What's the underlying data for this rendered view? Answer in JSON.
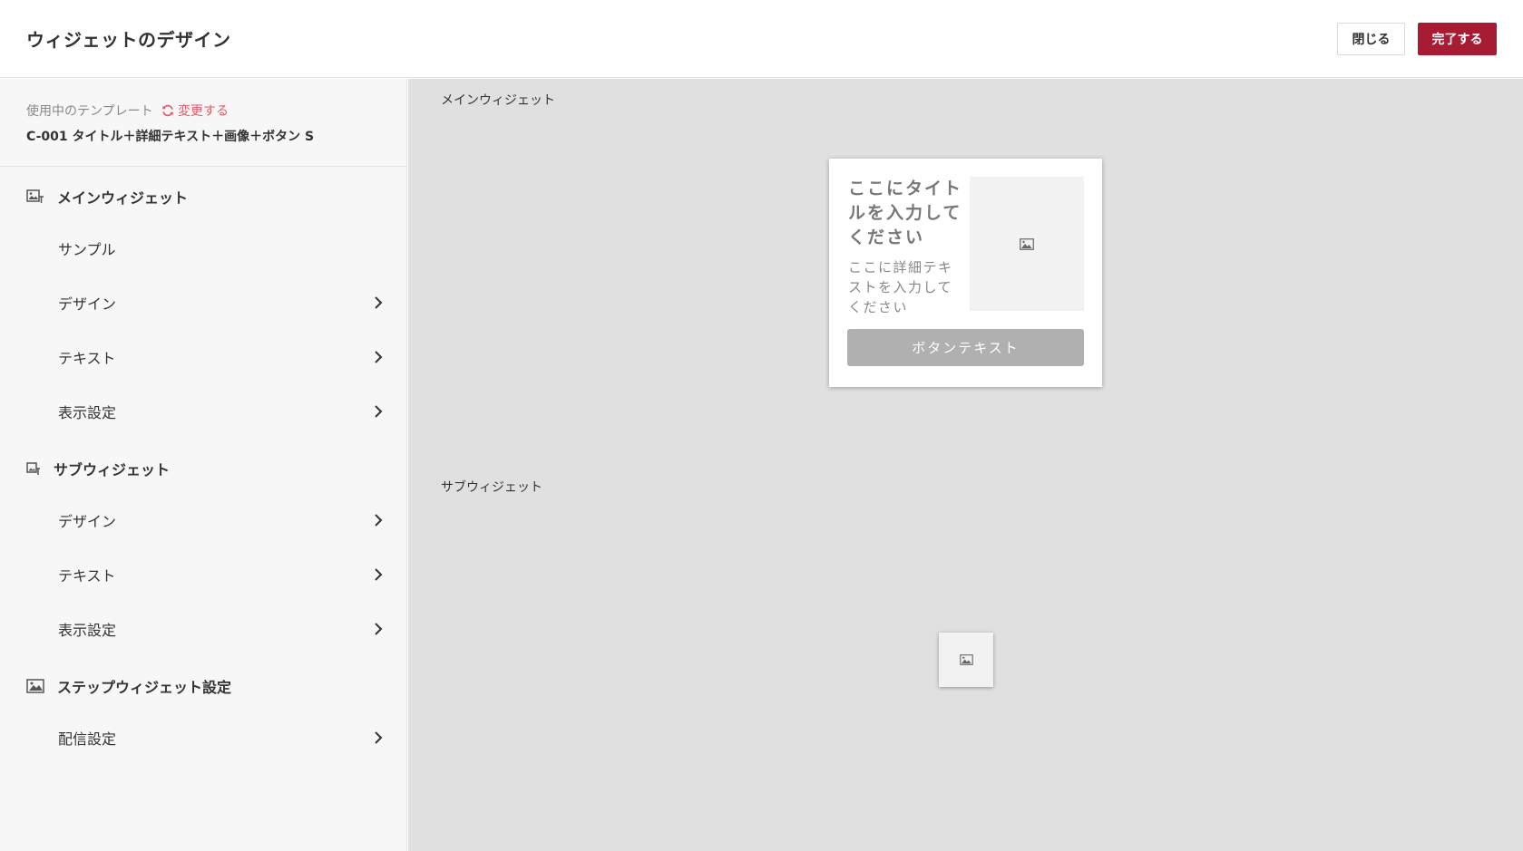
{
  "header": {
    "title": "ウィジェットのデザイン",
    "close_label": "閉じる",
    "done_label": "完了する"
  },
  "template": {
    "label": "使用中のテンプレート",
    "change_label": "変更する",
    "name": "C-001 タイトル＋詳細テキスト＋画像＋ボタン S"
  },
  "sidebar": {
    "main_widget": {
      "title": "メインウィジェット",
      "items": [
        {
          "label": "サンプル"
        },
        {
          "label": "デザイン"
        },
        {
          "label": "テキスト"
        },
        {
          "label": "表示設定"
        }
      ]
    },
    "sub_widget": {
      "title": "サブウィジェット",
      "items": [
        {
          "label": "デザイン"
        },
        {
          "label": "テキスト"
        },
        {
          "label": "表示設定"
        }
      ]
    },
    "step_widget": {
      "title": "ステップウィジェット設定",
      "items": [
        {
          "label": "配信設定"
        }
      ]
    }
  },
  "canvas": {
    "main_label": "メインウィジェット",
    "sub_label": "サブウィジェット",
    "main_widget": {
      "title": "ここにタイトルを入力してください",
      "detail": "ここに詳細テキストを入力してください",
      "button": "ボタンテキスト"
    }
  },
  "colors": {
    "accent": "#a81c33",
    "link": "#e05a6a",
    "canvas_bg": "#e0e0e0"
  }
}
